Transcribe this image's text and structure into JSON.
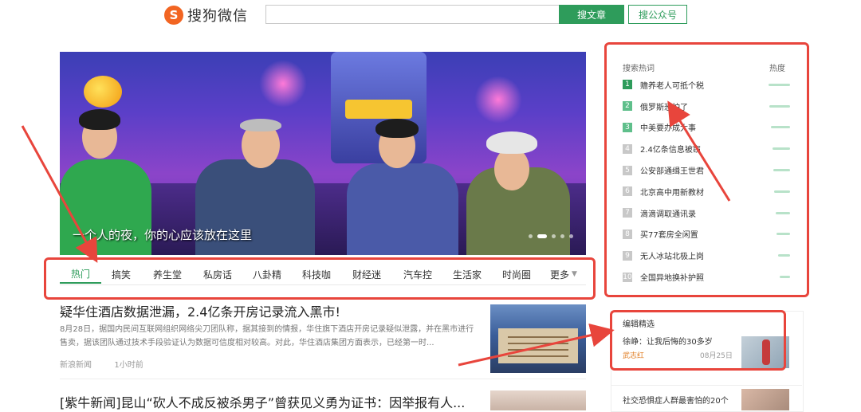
{
  "header": {
    "logo_mark": "S",
    "logo_text": "搜狗微信",
    "search_placeholder": "",
    "search_article_button": "搜文章",
    "search_account_button": "搜公众号"
  },
  "hero": {
    "caption": "一个人的夜，你的心应该放在这里"
  },
  "tabs": [
    {
      "label": "热门"
    },
    {
      "label": "搞笑"
    },
    {
      "label": "养生堂"
    },
    {
      "label": "私房话"
    },
    {
      "label": "八卦精"
    },
    {
      "label": "科技咖"
    },
    {
      "label": "财经迷"
    },
    {
      "label": "汽车控"
    },
    {
      "label": "生活家"
    },
    {
      "label": "时尚圈"
    },
    {
      "label": "更多"
    }
  ],
  "articles": [
    {
      "title": "疑华住酒店数据泄漏，2.4亿条开房记录流入黑市!",
      "summary": "8月28日，据国内民间互联网组织网络尖刀团队称，据其接到的情报，华住旗下酒店开房记录疑似泄露，并在黑市进行售卖，据该团队通过技术手段验证认为数据可信度相对较高。对此，华住酒店集团方面表示，已经第一时...",
      "source": "新浪新闻",
      "time": "1小时前"
    },
    {
      "title": "[紫牛新闻]昆山“砍人不成反被杀男子”曾获见义勇为证书：因举报有人..."
    }
  ],
  "hot_search": {
    "title": "搜索热词",
    "heat_label": "热度",
    "items": [
      {
        "rank": "1",
        "text": "赡养老人可抵个税",
        "heat": 0.95
      },
      {
        "rank": "2",
        "text": "俄罗斯恐怕了",
        "heat": 0.92
      },
      {
        "rank": "3",
        "text": "中美要办成大事",
        "heat": 0.85
      },
      {
        "rank": "4",
        "text": "2.4亿条信息被窃",
        "heat": 0.8
      },
      {
        "rank": "5",
        "text": "公安部通缉王世君",
        "heat": 0.75
      },
      {
        "rank": "6",
        "text": "北京高中用新教材",
        "heat": 0.7
      },
      {
        "rank": "7",
        "text": "滴滴调取通讯录",
        "heat": 0.65
      },
      {
        "rank": "8",
        "text": "买77套房全闲置",
        "heat": 0.6
      },
      {
        "rank": "9",
        "text": "无人冰站北极上岗",
        "heat": 0.55
      },
      {
        "rank": "10",
        "text": "全国异地换补护照",
        "heat": 0.45
      }
    ]
  },
  "editor_picks": {
    "title": "编辑精选",
    "item_title": "徐峥：让我后悔的30多岁",
    "author": "武志红",
    "date": "08月25日"
  },
  "social_item": "社交恐惧症人群最害怕的20个",
  "colors": {
    "brand_green": "#2e9c5b",
    "annotation_red": "#e8453c",
    "logo_orange": "#f26522"
  }
}
